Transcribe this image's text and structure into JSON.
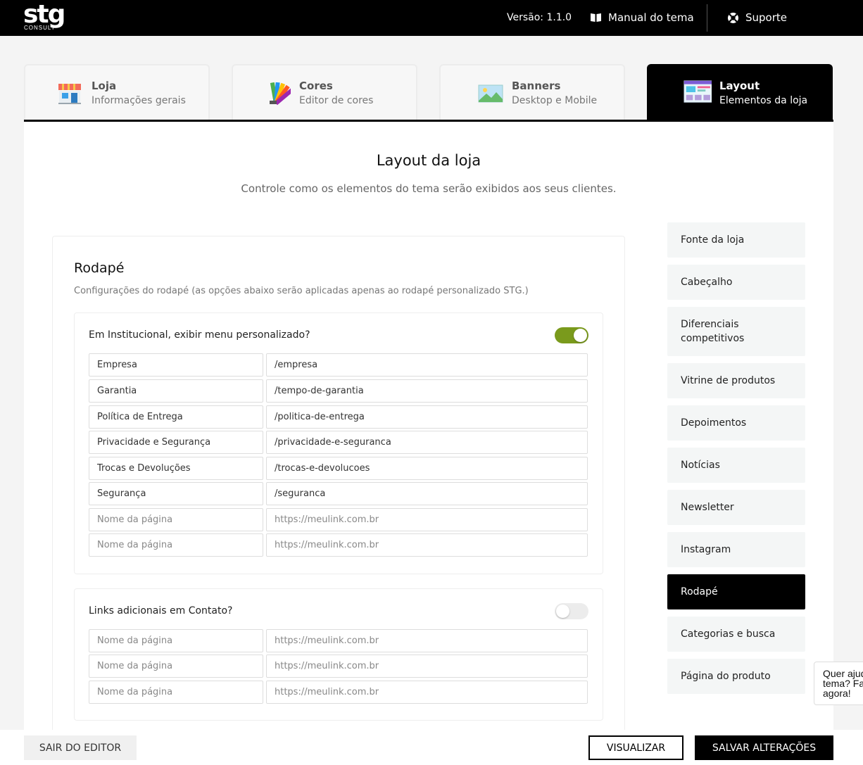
{
  "header": {
    "logo_main": "stg",
    "logo_sub": "CONSULT",
    "version": "Versão: 1.1.0",
    "manual_label": "Manual do tema",
    "support_label": "Suporte"
  },
  "tabs": [
    {
      "title": "Loja",
      "subtitle": "Informações gerais",
      "icon": "store-icon"
    },
    {
      "title": "Cores",
      "subtitle": "Editor de cores",
      "icon": "palette-icon"
    },
    {
      "title": "Banners",
      "subtitle": "Desktop e Mobile",
      "icon": "landscape-image-icon"
    },
    {
      "title": "Layout",
      "subtitle": "Elementos da loja",
      "icon": "layout-icon",
      "active": true
    }
  ],
  "page": {
    "title": "Layout da loja",
    "subtitle": "Controle como os elementos do tema serão exibidos aos seus clientes."
  },
  "card": {
    "title": "Rodapé",
    "description": "Configurações do rodapé (as opções abaixo serão aplicadas apenas ao rodapé personalizado STG.)"
  },
  "institucional": {
    "label": "Em Institucional, exibir menu personalizado?",
    "enabled": true,
    "rows": [
      {
        "name": "Empresa",
        "link": "/empresa"
      },
      {
        "name": "Garantia",
        "link": "/tempo-de-garantia"
      },
      {
        "name": "Política de Entrega",
        "link": "/politica-de-entrega"
      },
      {
        "name": "Privacidade e Segurança",
        "link": "/privacidade-e-seguranca"
      },
      {
        "name": "Trocas e Devoluções",
        "link": "/trocas-e-devolucoes"
      },
      {
        "name": "Segurança",
        "link": "/seguranca"
      },
      {
        "name": "",
        "link": ""
      },
      {
        "name": "",
        "link": ""
      }
    ]
  },
  "contato": {
    "label": "Links adicionais em Contato?",
    "enabled": false,
    "rows": [
      {
        "name": "",
        "link": ""
      },
      {
        "name": "",
        "link": ""
      },
      {
        "name": "",
        "link": ""
      }
    ]
  },
  "placeholders": {
    "name": "Nome da página",
    "link": "https://meulink.com.br"
  },
  "sidebar": {
    "items": [
      {
        "label": "Fonte da loja"
      },
      {
        "label": "Cabeçalho"
      },
      {
        "label": "Diferenciais competitivos"
      },
      {
        "label": "Vitrine de produtos"
      },
      {
        "label": "Depoimentos"
      },
      {
        "label": "Notícias"
      },
      {
        "label": "Newsletter"
      },
      {
        "label": "Instagram"
      },
      {
        "label": "Rodapé",
        "active": true
      },
      {
        "label": "Categorias e busca"
      },
      {
        "label": "Página do produto"
      }
    ]
  },
  "help": {
    "line1": "Quer ajuda",
    "line2": "tema? Fal",
    "line3": "agora!"
  },
  "footer": {
    "exit_label": "SAIR DO EDITOR",
    "view_label": "VISUALIZAR",
    "save_label": "SALVAR ALTERAÇÕES"
  },
  "colors": {
    "toggle_on": "#7a9a1c",
    "accent": "#000000"
  }
}
